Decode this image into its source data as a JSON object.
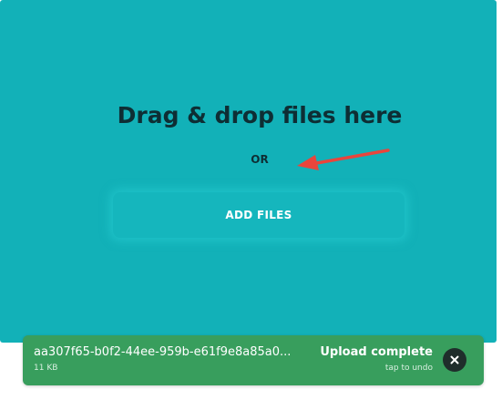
{
  "dropzone": {
    "title": "Drag & drop files here",
    "separator": "OR",
    "add_files_label": "ADD FILES"
  },
  "file_item": {
    "name": "aa307f65-b0f2-44ee-959b-e61f9e8a85a0...",
    "size": "11 KB",
    "status": "Upload complete",
    "status_hint": "tap to undo",
    "close_icon": "close-icon"
  },
  "colors": {
    "dropzone_bg": "#12b1b8",
    "success_bg": "#389e5d",
    "annotation_arrow": "#e8453c"
  }
}
